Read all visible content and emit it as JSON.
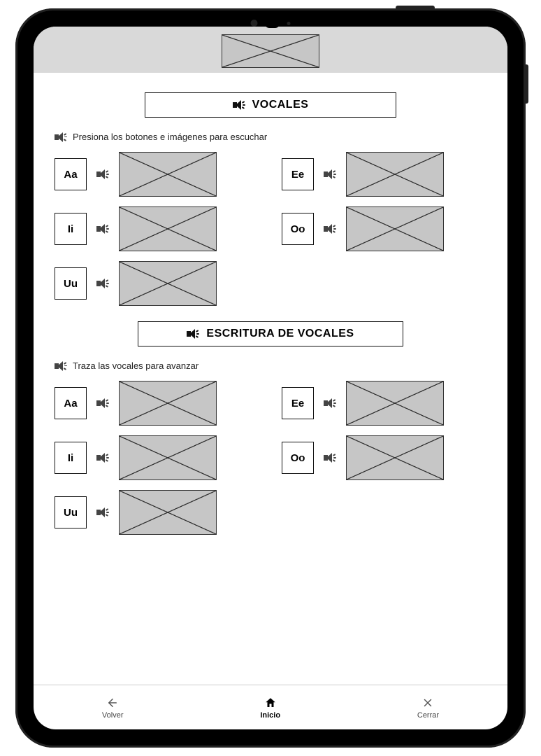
{
  "section1": {
    "title": "VOCALES",
    "instruction": "Presiona los botones e imágenes para escuchar",
    "items": [
      {
        "label": "Aa"
      },
      {
        "label": "Ee"
      },
      {
        "label": "Ii"
      },
      {
        "label": "Oo"
      },
      {
        "label": "Uu"
      }
    ]
  },
  "section2": {
    "title": "ESCRITURA DE VOCALES",
    "instruction": "Traza las vocales para avanzar",
    "items": [
      {
        "label": "Aa"
      },
      {
        "label": "Ee"
      },
      {
        "label": "Ii"
      },
      {
        "label": "Oo"
      },
      {
        "label": "Uu"
      }
    ]
  },
  "nav": {
    "back": "Volver",
    "home": "Inicio",
    "close": "Cerrar"
  }
}
